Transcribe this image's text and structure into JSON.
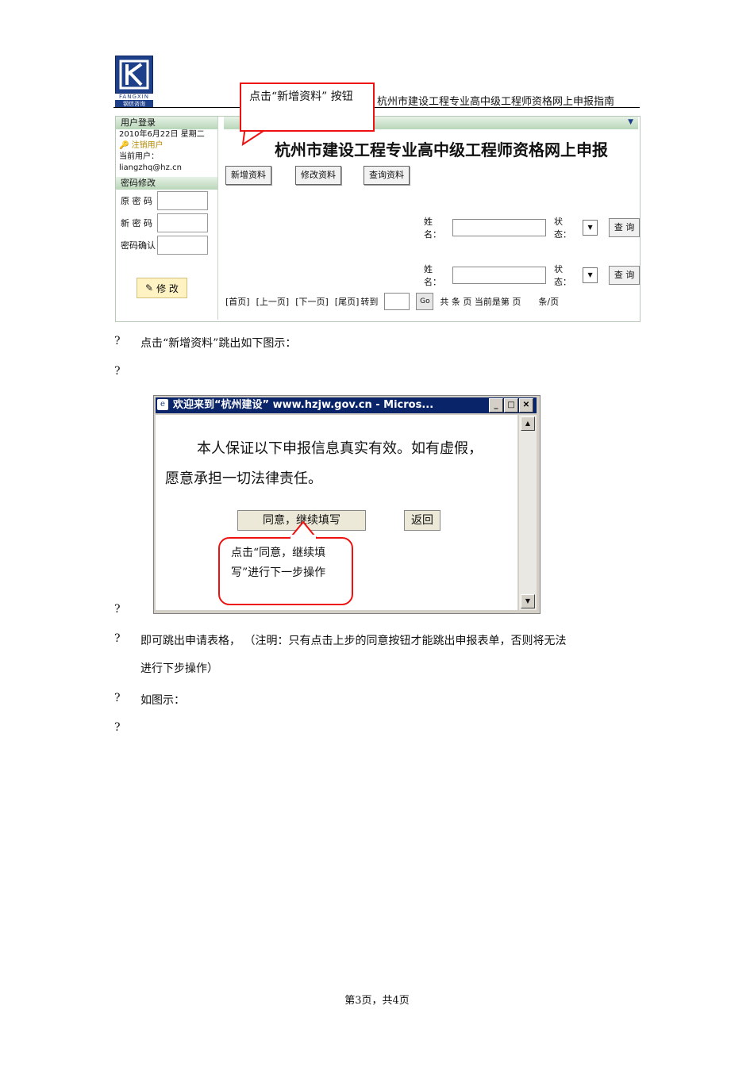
{
  "header": {
    "logo_top_text": "FANGXIN",
    "logo_bottom_text": "钢信咨询",
    "doc_title": "杭州市建设工程专业高中级工程师资格网上申报指南"
  },
  "screenshot1": {
    "sidebar": {
      "login_header": "用户登录",
      "date": "2010年6月22日  星期二",
      "logout": "注销用户",
      "current_user_label": "当前用户：",
      "current_user": "liangzhq@hz.cn",
      "pw_header": "密码修改",
      "old_pw_label": "原 密 码",
      "new_pw_label": "新 密 码",
      "confirm_pw_label": "密码确认",
      "modify_button": "修 改"
    },
    "main": {
      "title": "杭州市建设工程专业高中级工程师资格网上申报",
      "btn_new": "新增资料",
      "btn_edit": "修改资料",
      "btn_query": "查询资料",
      "name_label": "姓名：",
      "status_label": "状态：",
      "search_button": "查 询",
      "pager": {
        "first": "[首页]",
        "prev": "[上一页]",
        "next": "[下一页]",
        "last": "[尾页]",
        "goto": "转到",
        "go": "Go",
        "total": "共 条 页 当前是第 页",
        "per_page": "条/页"
      }
    }
  },
  "callout1": "点击“新增资料” 按钮",
  "text": {
    "bullet": "?",
    "p1": "点击“新增资料”跳出如下图示：",
    "p2_line1": "即可跳出申请表格，   （注明：只有点击上步的同意按钮才能跳出申报表单，否则将无法",
    "p2_line2": "进行下步操作）",
    "p3": "如图示："
  },
  "dialog": {
    "title": "欢迎来到“杭州建设”  www.hzjw.gov.cn - Micros...",
    "pledge_line1": "本人保证以下申报信息真实有效。如有虚假，",
    "pledge_line2": "愿意承担一切法律责任。",
    "agree_button": "同意，继续填写",
    "back_button": "返回"
  },
  "callout2": "点击“同意，继续填写”进行下一步操作",
  "footer": "第3页，共4页"
}
